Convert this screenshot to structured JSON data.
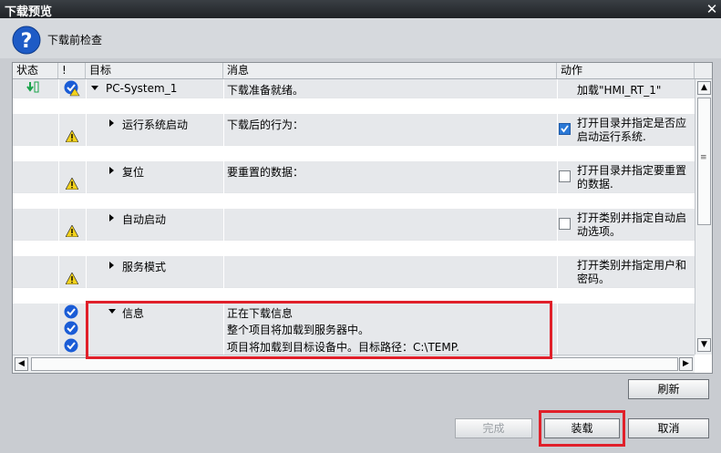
{
  "window": {
    "title": "下载预览",
    "close_icon": "close-icon"
  },
  "header": {
    "title": "下载前检查",
    "icon": "question-icon"
  },
  "columns": {
    "status": "状态",
    "excl": "!",
    "target": "目标",
    "message": "消息",
    "action": "动作"
  },
  "rows": {
    "r0": {
      "target": "PC-System_1",
      "message": "下载准备就绪。",
      "action": "加载\"HMI_RT_1\""
    },
    "r1": {
      "target": "运行系统启动",
      "message": "下载后的行为：",
      "action": "打开目录并指定是否应启动运行系统.",
      "checked": true
    },
    "r2": {
      "target": "复位",
      "message": "要重置的数据：",
      "action": "打开目录并指定要重置的数据.",
      "checked": false
    },
    "r3": {
      "target": "自动启动",
      "message": "",
      "action": "打开类别并指定自动启动选项。",
      "checked": false
    },
    "r4": {
      "target": "服务模式",
      "message": "",
      "action": "打开类别并指定用户和密码。"
    },
    "r5": {
      "target": "信息",
      "message": "正在下载信息"
    },
    "r6": {
      "message": "整个项目将加载到服务器中。"
    },
    "r7": {
      "message": "项目将加载到目标设备中。目标路径：C:\\TEMP."
    }
  },
  "buttons": {
    "refresh": "刷新",
    "finish": "完成",
    "load": "装载",
    "cancel": "取消"
  },
  "scrollbar_grip": "Ⅲ",
  "colors": {
    "accent_highlight": "#e0202a",
    "title_bar": "#2b2f33",
    "check_icon": "#1a5cd6",
    "warning_icon": "#f3d21b"
  }
}
